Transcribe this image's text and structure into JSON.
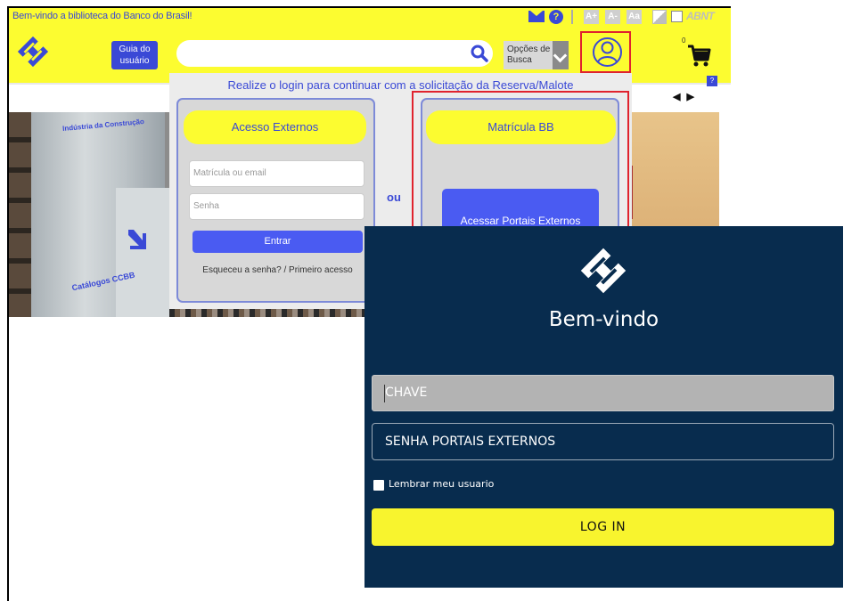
{
  "topbar": {
    "welcome_text": "Bem-vindo a biblioteca do Banco do Brasil!",
    "font_increase": "A+",
    "font_decrease": "A-",
    "font_reset": "Aa",
    "abnt": "ABNT"
  },
  "header": {
    "guide_label": "Guia do usuário",
    "search_placeholder": "",
    "options_label": "Opções de Busca",
    "cart_count": "0",
    "help_badge": "?"
  },
  "carousel": {
    "sign_top": "Indústria da Construção",
    "sign_bottom": "Catálogos CCBB",
    "nav": "◀ ▶"
  },
  "login_popup": {
    "message": "Realize o login para continuar com a solicitação da Reserva/Malote",
    "external": {
      "title": "Acesso Externos",
      "username_placeholder": "Matrícula ou email",
      "password_placeholder": "Senha",
      "submit_label": "Entrar",
      "forgot_link": "Esqueceu a senha? / Primeiro acesso"
    },
    "or_text": "ou",
    "bb": {
      "title": "Matrícula BB",
      "portal_button": "Acessar Portais Externos"
    }
  },
  "modal": {
    "title": "Bem-vindo",
    "key_placeholder": "CHAVE",
    "password_placeholder": "SENHA PORTAIS EXTERNOS",
    "remember_label": "Lembrar meu usuario",
    "login_label": "LOG IN"
  },
  "colors": {
    "brand_yellow": "#fcfc30",
    "brand_blue": "#3a49d6",
    "modal_navy": "#082c4e",
    "highlight_red": "#e0232e"
  }
}
